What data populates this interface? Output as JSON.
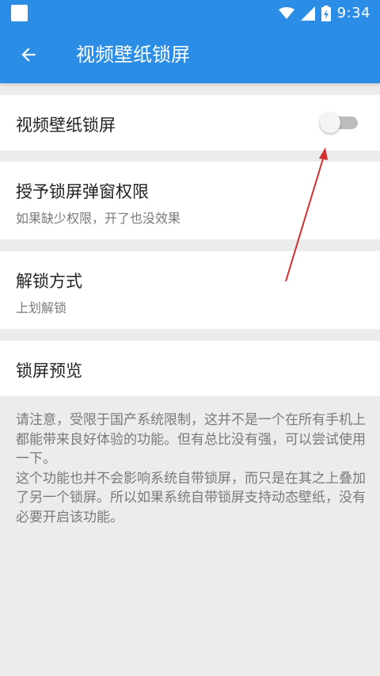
{
  "status_bar": {
    "time": "9:34",
    "icons": [
      "wifi-icon",
      "signal-icon",
      "battery-charging-icon"
    ]
  },
  "app_bar": {
    "title": "视频壁纸锁屏",
    "back_icon": "arrow-left-icon"
  },
  "settings": [
    {
      "title": "视频壁纸锁屏",
      "subtitle": "",
      "toggle": false
    },
    {
      "title": "授予锁屏弹窗权限",
      "subtitle": "如果缺少权限，开了也没效果"
    },
    {
      "title": "解锁方式",
      "subtitle": "上划解锁"
    },
    {
      "title": "锁屏预览",
      "subtitle": ""
    }
  ],
  "note": "请注意，受限于国产系统限制，这并不是一个在所有手机上都能带来良好体验的功能。但有总比没有强，可以尝试使用一下。\n这个功能也并不会影响系统自带锁屏，而只是在其之上叠加了另一个锁屏。所以如果系统自带锁屏支持动态壁纸，没有必要开启该功能。",
  "colors": {
    "primary": "#2b8de6",
    "background": "#ececec",
    "annotation_arrow": "#d32f2f"
  }
}
